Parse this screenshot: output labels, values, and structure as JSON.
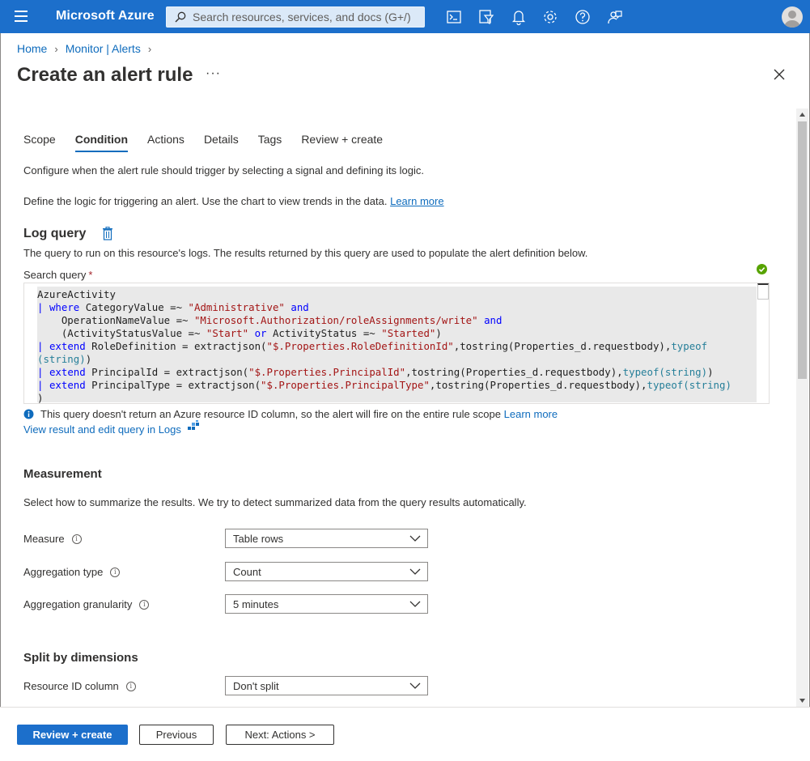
{
  "topbar": {
    "brand": "Microsoft Azure",
    "search_placeholder": "Search resources, services, and docs (G+/)",
    "icons": [
      "cloud-shell-icon",
      "directory-filter-icon",
      "notifications-icon",
      "settings-icon",
      "help-icon",
      "feedback-icon"
    ],
    "accent_color": "#1c6fcb"
  },
  "breadcrumb": {
    "items": [
      "Home",
      "Monitor | Alerts"
    ]
  },
  "page": {
    "title": "Create an alert rule",
    "more": "···"
  },
  "tabs": [
    "Scope",
    "Condition",
    "Actions",
    "Details",
    "Tags",
    "Review + create"
  ],
  "active_tab": "Condition",
  "intro": {
    "configure": "Configure when the alert rule should trigger by selecting a signal and defining its logic.",
    "define": "Define the logic for triggering an alert. Use the chart to view trends in the data.",
    "learn_more": "Learn more"
  },
  "log_query": {
    "title": "Log query",
    "description": "The query to run on this resource's logs. The results returned by this query are used to populate the alert definition below.",
    "search_label": "Search query",
    "required_mark": "*",
    "lines": [
      "AzureActivity",
      "| where CategoryValue =~ \"Administrative\" and",
      "    OperationNameValue =~ \"Microsoft.Authorization/roleAssignments/write\" and",
      "    (ActivityStatusValue =~ \"Start\" or ActivityStatus =~ \"Started\")",
      "| extend RoleDefinition = extractjson(\"$.Properties.RoleDefinitionId\",tostring(Properties_d.requestbody),typeof",
      "(string))",
      "| extend PrincipalId = extractjson(\"$.Properties.PrincipalId\",tostring(Properties_d.requestbody),typeof(string))",
      "| extend PrincipalType = extractjson(\"$.Properties.PrincipalType\",tostring(Properties_d.requestbody),typeof(string)",
      ")"
    ],
    "info_text": "This query doesn't return an Azure resource ID column, so the alert will fire on the entire rule scope",
    "info_learn_more": "Learn more",
    "logs_link": "View result and edit query in Logs"
  },
  "measurement": {
    "title": "Measurement",
    "description": "Select how to summarize the results. We try to detect summarized data from the query results automatically.",
    "fields": [
      {
        "label": "Measure",
        "value": "Table rows"
      },
      {
        "label": "Aggregation type",
        "value": "Count"
      },
      {
        "label": "Aggregation granularity",
        "value": "5 minutes"
      }
    ]
  },
  "split": {
    "title": "Split by dimensions",
    "fields": [
      {
        "label": "Resource ID column",
        "value": "Don't split"
      }
    ]
  },
  "footer": {
    "review_create": "Review + create",
    "previous": "Previous",
    "next": "Next: Actions >"
  }
}
